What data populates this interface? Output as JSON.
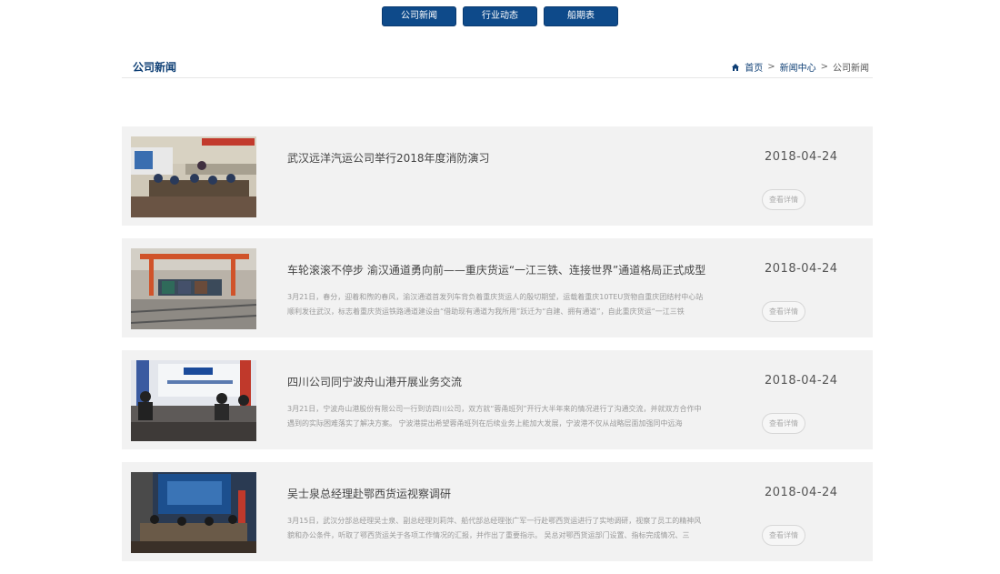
{
  "topnav": {
    "items": [
      {
        "label": "公司新闻"
      },
      {
        "label": "行业动态"
      },
      {
        "label": "船期表"
      }
    ]
  },
  "header": {
    "title": "公司新闻",
    "breadcrumb": {
      "home": "首页",
      "section": "新闻中心",
      "current": "公司新闻",
      "separator": ">"
    }
  },
  "news": [
    {
      "title": "武汉远洋汽运公司举行2018年度消防演习",
      "summary": "",
      "date": "2018-04-24",
      "detail_label": "查看详情"
    },
    {
      "title": "车轮滚滚不停步 渝汉通道勇向前——重庆货运“一江三铁、连接世界”通道格局正式成型",
      "summary": "3月21日，春分，迎着和煦的春风，渝汉通道首发列车背负着重庆货运人的殷切期望，运载着重庆10TEU货物自重庆团结村中心站顺利发往武汉，标志着重庆货运铁路通道建设由“借助现有通道为我所用”跃迁为“自建、拥有通道”，自此重庆货运“一江三铁",
      "date": "2018-04-24",
      "detail_label": "查看详情"
    },
    {
      "title": "四川公司同宁波舟山港开展业务交流",
      "summary": "3月21日，宁波舟山港股份有限公司一行到访四川公司，双方就“蓉甬班列”开行大半年来的情况进行了沟通交流，并就双方合作中遇到的实际困难落实了解决方案。 宁波港提出希望蓉甬班列在后续业务上能加大发展，宁波港不仅从战略层面加强同中远海",
      "date": "2018-04-24",
      "detail_label": "查看详情"
    },
    {
      "title": "吴士泉总经理赴鄂西货运视察调研",
      "summary": "3月15日，武汉分部总经理吴士泉、副总经理刘莉萍、船代部总经理张广军一行赴鄂西货运进行了实地调研，视察了员工的精神风貌和办公条件，听取了鄂西货运关于各项工作情况的汇报，并作出了重要指示。 吴总对鄂西货运部门设置、指标完成情况、三",
      "date": "2018-04-24",
      "detail_label": "查看详情"
    }
  ]
}
